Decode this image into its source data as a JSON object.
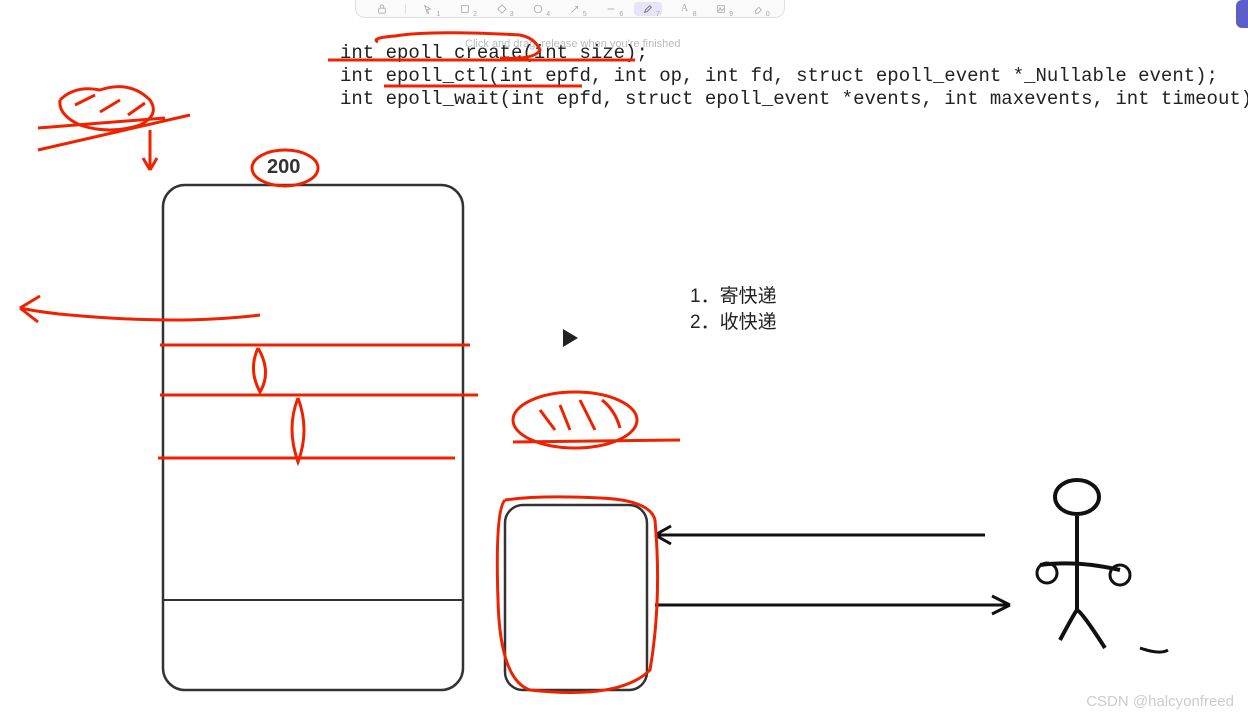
{
  "toolbar": {
    "hint": "Click and drag, release when you're finished",
    "items": [
      {
        "name": "lock-icon",
        "sub": ""
      },
      {
        "name": "pointer-icon",
        "sub": "1"
      },
      {
        "name": "rect-icon",
        "sub": "2"
      },
      {
        "name": "diamond-icon",
        "sub": "3"
      },
      {
        "name": "circle-icon",
        "sub": "4"
      },
      {
        "name": "arrow-icon",
        "sub": "5"
      },
      {
        "name": "line-icon",
        "sub": "6"
      },
      {
        "name": "pencil-icon",
        "sub": "7",
        "selected": true
      },
      {
        "name": "text-icon",
        "sub": "8"
      },
      {
        "name": "image-icon",
        "sub": "9"
      },
      {
        "name": "eraser-icon",
        "sub": "0"
      }
    ]
  },
  "code": {
    "line1": "int epoll_create(int size);",
    "line2": "int epoll_ctl(int epfd, int op, int fd, struct epoll_event *_Nullable event);",
    "line3": "int epoll_wait(int epfd, struct epoll_event *events, int maxevents, int timeout);"
  },
  "labels": {
    "num200": "200"
  },
  "list": {
    "item1": "1．寄快递",
    "item2": "2．收快递"
  },
  "watermark": "CSDN @halcyonfreed"
}
